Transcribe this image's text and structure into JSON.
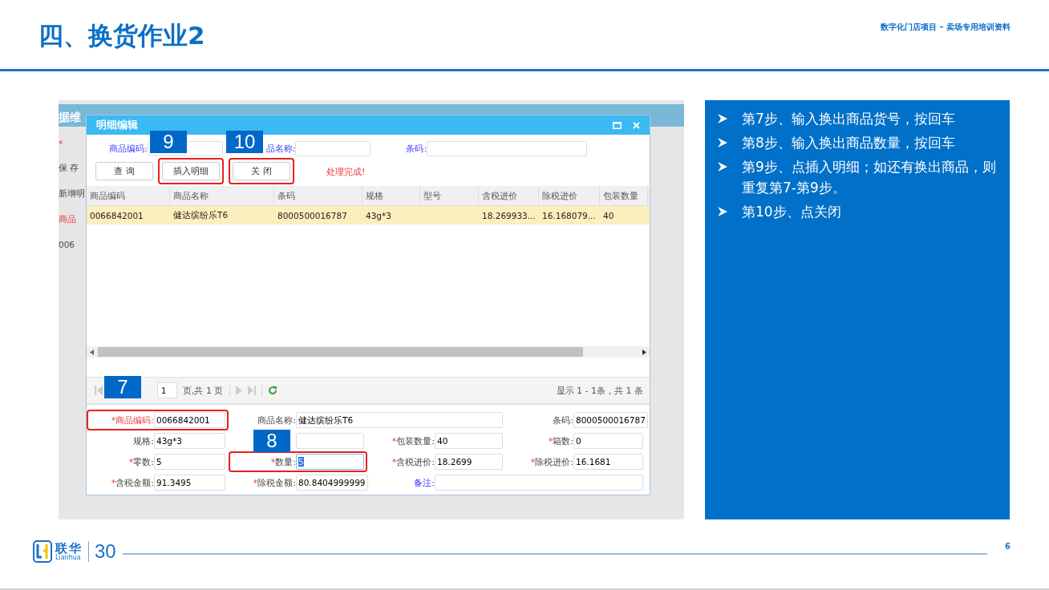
{
  "header": {
    "title": "四、换货作业2",
    "subtitle": "数字化门店项目 – 卖场专用培训资料"
  },
  "screenshot": {
    "background_app": {
      "title": "据维",
      "fragments": [
        {
          "text": "*",
          "kind": "error"
        },
        {
          "text": "保 存",
          "kind": "plain"
        },
        {
          "text": "新增明",
          "kind": "plain"
        },
        {
          "text": "商品",
          "kind": "error"
        },
        {
          "text": "006",
          "kind": "plain"
        }
      ]
    },
    "dialog": {
      "title": "明细编辑",
      "search": [
        {
          "label": "商品编码:"
        },
        {
          "label": "品名称:"
        },
        {
          "label": "条码:"
        }
      ],
      "buttons": [
        {
          "label": "查 询",
          "marked": false
        },
        {
          "label": "插入明细",
          "marked": true,
          "callout": "9"
        },
        {
          "label": "关 闭",
          "marked": true,
          "callout": "10"
        }
      ],
      "status": "处理完成!",
      "table": {
        "columns": [
          "商品编码",
          "商品名称",
          "条码",
          "规格",
          "型号",
          "含税进价",
          "除税进价",
          "包装数量"
        ],
        "rows": [
          {
            "selected": true,
            "cells": [
              "0066842001",
              "健达缤纷乐T6",
              "8000500016787",
              "43g*3",
              "",
              "18.269933...",
              "16.168079...",
              "40"
            ]
          }
        ]
      },
      "pager": {
        "page": "1",
        "page_text": "页,共 1 页",
        "summary": "显示 1 - 1条，共 1 条"
      },
      "form": [
        {
          "kind": "field",
          "label": "商品编码:",
          "required": true,
          "invalid": true,
          "value": "0066842001",
          "marked": true,
          "callout": "7",
          "focused": false
        },
        {
          "kind": "wide",
          "label": "商品名称:",
          "required": false,
          "invalid": false,
          "value": "健达缤纷乐T6",
          "marked": false,
          "focused": false
        },
        {
          "kind": "field",
          "label": "条码:",
          "required": false,
          "invalid": false,
          "value": "8000500016787",
          "marked": false,
          "focused": false
        },
        {
          "kind": "field",
          "label": "规格:",
          "required": false,
          "invalid": false,
          "value": "43g*3",
          "marked": false,
          "focused": false
        },
        {
          "kind": "field",
          "marked": false,
          "focused": false
        },
        {
          "kind": "field",
          "label": "包装数量:",
          "required": true,
          "invalid": false,
          "value": "40",
          "marked": false,
          "focused": false
        },
        {
          "kind": "field",
          "label": "箱数:",
          "required": true,
          "invalid": false,
          "value": "0",
          "marked": false,
          "focused": false
        },
        {
          "kind": "field",
          "label": "零数:",
          "required": true,
          "invalid": false,
          "value": "5",
          "marked": false,
          "focused": false
        },
        {
          "kind": "field",
          "label": "数量:",
          "required": true,
          "invalid": false,
          "value": "5",
          "marked": true,
          "callout": "8",
          "focused": true
        },
        {
          "kind": "field",
          "label": "含税进价:",
          "required": true,
          "invalid": false,
          "value": "18.2699",
          "marked": false,
          "focused": false
        },
        {
          "kind": "field",
          "label": "除税进价:",
          "required": true,
          "invalid": false,
          "value": "16.1681",
          "marked": false,
          "focused": false
        },
        {
          "kind": "field",
          "label": "含税金额:",
          "required": true,
          "invalid": false,
          "value": "91.3495",
          "marked": false,
          "focused": false
        },
        {
          "kind": "field",
          "label": "除税金额:",
          "required": true,
          "invalid": false,
          "value": "80.8404999999",
          "marked": false,
          "focused": false
        },
        {
          "kind": "note",
          "label": "备注:",
          "required": false,
          "invalid": false,
          "marked": false,
          "focused": false
        }
      ]
    }
  },
  "steps": [
    "第7步、输入换出商品货号，按回车",
    "第8步、输入换出商品数量，按回车",
    "第9步、点插入明细；如还有换出商品，则重复第7-第9步。",
    "第10步、点关闭"
  ],
  "footer": {
    "logo_name": "联华",
    "logo_latin": "Lianhua",
    "anniversary": "30",
    "page_number": "6"
  }
}
